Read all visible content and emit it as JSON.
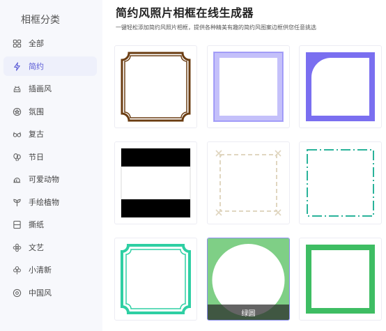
{
  "sidebar": {
    "title": "相框分类",
    "items": [
      {
        "label": "全部",
        "icon": "grid-icon"
      },
      {
        "label": "简约",
        "icon": "lightning-icon",
        "active": true
      },
      {
        "label": "插画风",
        "icon": "android-icon"
      },
      {
        "label": "氛围",
        "icon": "badge-icon"
      },
      {
        "label": "复古",
        "icon": "glasses-icon"
      },
      {
        "label": "节日",
        "icon": "balloon-icon"
      },
      {
        "label": "可爱动物",
        "icon": "snail-icon"
      },
      {
        "label": "手绘植物",
        "icon": "sprout-icon"
      },
      {
        "label": "撕纸",
        "icon": "paper-icon"
      },
      {
        "label": "文艺",
        "icon": "flower-icon"
      },
      {
        "label": "小清新",
        "icon": "clover-icon"
      },
      {
        "label": "中国风",
        "icon": "target-icon"
      }
    ]
  },
  "header": {
    "title": "简约风照片相框在线生成器",
    "subtitle": "一键轻松添加简约风照片相框，提供各种精美有趣的简约风图案边框供您任意挑选"
  },
  "frames": [
    {
      "name": "brown-scalloped-frame",
      "color": "#6b3d12"
    },
    {
      "name": "lavender-square-frame",
      "color": "#7d74f5"
    },
    {
      "name": "purple-rounded-corner-frame",
      "color": "#7a6ff0"
    },
    {
      "name": "black-bars-frame",
      "color": "#000000"
    },
    {
      "name": "beige-dashed-frame",
      "color": "#e0d6c0"
    },
    {
      "name": "teal-dash-dot-frame",
      "color": "#2ab39a"
    },
    {
      "name": "mint-scalloped-frame",
      "color": "#2ecfa3"
    },
    {
      "name": "green-circle-frame",
      "color": "#7fcf86",
      "label": "绿圆",
      "selected": true
    },
    {
      "name": "green-square-frame",
      "color": "#3ebd63"
    }
  ]
}
